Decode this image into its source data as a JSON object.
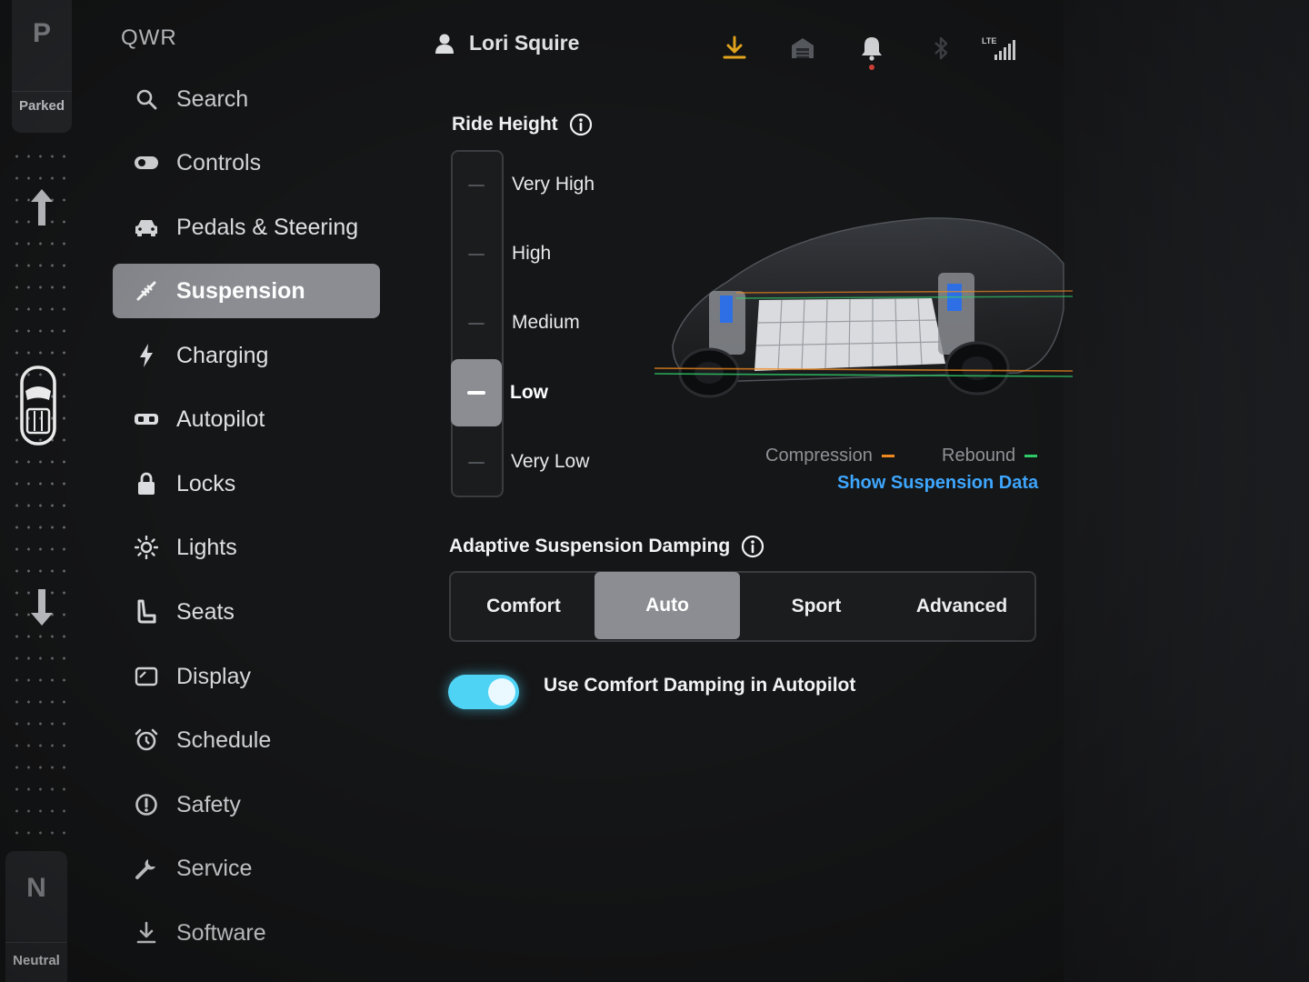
{
  "gear": {
    "top_letter": "P",
    "top_label": "Parked",
    "bottom_letter": "N",
    "bottom_label": "Neutral"
  },
  "sidebar": {
    "title": "QWR",
    "items": [
      {
        "label": "Search",
        "icon": "search-icon"
      },
      {
        "label": "Controls",
        "icon": "toggle-icon"
      },
      {
        "label": "Pedals & Steering",
        "icon": "car-icon"
      },
      {
        "label": "Suspension",
        "icon": "suspension-icon",
        "active": true
      },
      {
        "label": "Charging",
        "icon": "lightning-icon"
      },
      {
        "label": "Autopilot",
        "icon": "steering-icon"
      },
      {
        "label": "Locks",
        "icon": "lock-icon"
      },
      {
        "label": "Lights",
        "icon": "sun-icon"
      },
      {
        "label": "Seats",
        "icon": "seat-icon"
      },
      {
        "label": "Display",
        "icon": "display-icon"
      },
      {
        "label": "Schedule",
        "icon": "alarm-icon"
      },
      {
        "label": "Safety",
        "icon": "alert-circle-icon"
      },
      {
        "label": "Service",
        "icon": "wrench-icon"
      },
      {
        "label": "Software",
        "icon": "download-icon"
      }
    ]
  },
  "status": {
    "user_name": "Lori Squire",
    "download_color": "#f2b01e",
    "alert_dot_color": "#e0453a",
    "network_label": "LTE"
  },
  "ride_height": {
    "title": "Ride Height",
    "options": [
      "Very High",
      "High",
      "Medium",
      "Low",
      "Very Low"
    ],
    "selected": "Low"
  },
  "suspension_legend": {
    "compression_label": "Compression",
    "compression_color": "#f08a1e",
    "rebound_label": "Rebound",
    "rebound_color": "#2fd06a",
    "show_data_link": "Show Suspension Data",
    "link_color": "#3ea7ff"
  },
  "damping": {
    "title": "Adaptive Suspension Damping",
    "options": [
      "Comfort",
      "Auto",
      "Sport",
      "Advanced"
    ],
    "selected": "Auto"
  },
  "comfort_autopilot": {
    "label": "Use Comfort Damping in Autopilot",
    "enabled": true,
    "accent": "#4fd3f5"
  }
}
